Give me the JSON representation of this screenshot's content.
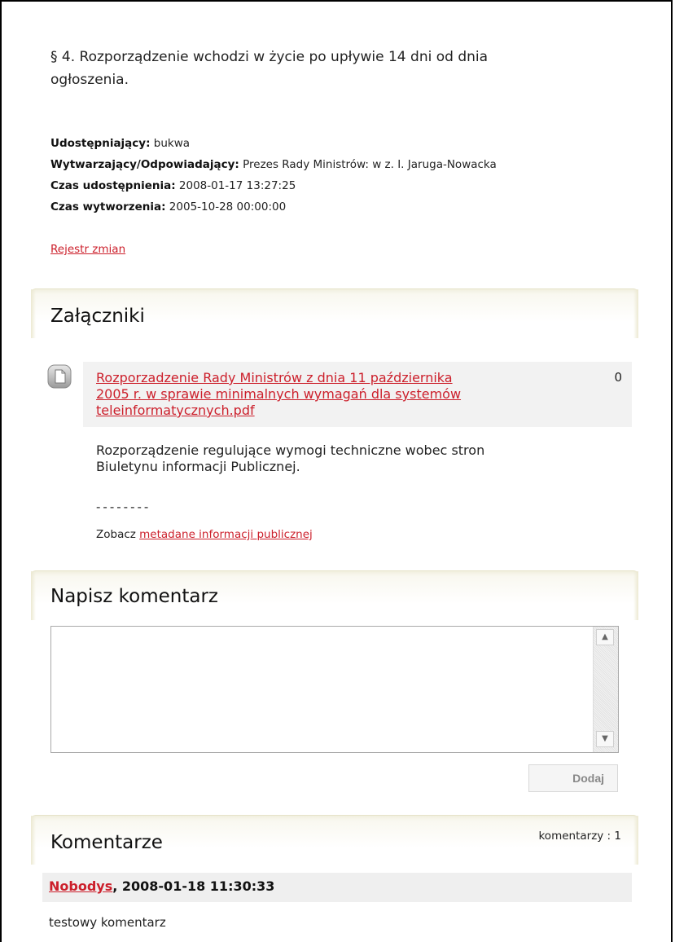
{
  "regulation": {
    "paragraph_line1": "§ 4. Rozporządzenie wchodzi w życie po upływie 14 dni od dnia",
    "paragraph_line2": "ogłoszenia."
  },
  "metadata": {
    "shared_by_label": "Udostępniający:",
    "shared_by_value": "bukwa",
    "producer_label": "Wytwarzający/Odpowiadający:",
    "producer_value": "Prezes Rady Ministrów: w z. I. Jaruga-Nowacka",
    "shared_time_label": "Czas udostępnienia:",
    "shared_time_value": "2008-01-17 13:27:25",
    "created_time_label": "Czas wytworzenia:",
    "created_time_value": "2005-10-28 00:00:00",
    "change_log_link": "Rejestr zmian"
  },
  "attachments": {
    "title": "Załączniki",
    "icon": "document-icon",
    "items": [
      {
        "link_line1": "Rozporzadzenie Rady Ministrów z dnia 11 października",
        "link_line2": "2005 r. w sprawie minimalnych wymagań dla systemów",
        "link_line3": "teleinformatycznych.pdf",
        "count": "0",
        "description_line1": "Rozporządzenie regulujące wymogi techniczne wobec stron",
        "description_line2": "Biuletynu informacji Publicznej."
      }
    ],
    "separator": "--------",
    "see_prefix": "Zobacz",
    "see_link": "metadane informacji publicznej"
  },
  "comment_form": {
    "title": "Napisz komentarz",
    "textarea_value": "",
    "submit_label": "Dodaj"
  },
  "comments": {
    "title": "Komentarze",
    "count_text": "komentarzy : 1",
    "items": [
      {
        "author": "Nobodys",
        "date": ", 2008-01-18 11:30:33",
        "text": "testowy komentarz"
      }
    ]
  }
}
